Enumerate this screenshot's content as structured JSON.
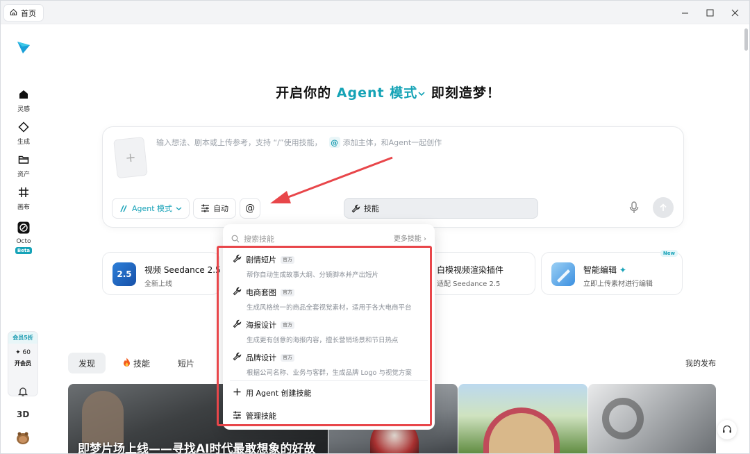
{
  "window": {
    "tab_label": "首页"
  },
  "sidebar": {
    "items": [
      {
        "label": "灵感"
      },
      {
        "label": "生成"
      },
      {
        "label": "资产"
      },
      {
        "label": "画布"
      },
      {
        "label": "Octo",
        "badge": "Beta"
      }
    ],
    "vip": {
      "promo": "会员5折",
      "points": "✦ 60",
      "open_label": "开会员"
    },
    "bottom_3d": "3D"
  },
  "hero": {
    "prefix": "开启你的",
    "mode": "Agent 模式",
    "suffix": "即刻造梦！"
  },
  "prompt": {
    "placeholder_left": "输入想法、剧本或上传参考，支持 “/”使用技能，",
    "placeholder_right": "添加主体，和Agent一起创作",
    "add_symbol": "+"
  },
  "toolbar": {
    "agent_label": "Agent 模式",
    "auto_label": "自动",
    "skill_label": "技能",
    "at_label": "@"
  },
  "feature_cards": [
    {
      "title": "视频 Seedance 2.5",
      "subtitle": "全新上线",
      "icon_text": "2.5"
    },
    {
      "title": "白模视频渲染插件",
      "subtitle": "适配 Seedance 2.5"
    },
    {
      "title": "智能编辑",
      "subtitle": "立即上传素材进行编辑",
      "badge": "New"
    }
  ],
  "content_tabs": [
    {
      "label": "发现"
    },
    {
      "label": "技能"
    },
    {
      "label": "短片"
    }
  ],
  "my_publish": "我的发布",
  "gallery": {
    "caption": "即梦片场上线——寻找AI时代最敢想象的好故"
  },
  "skills_menu": {
    "search_placeholder": "搜索技能",
    "more_label": "更多技能",
    "official_tag": "官方",
    "items": [
      {
        "name": "剧情短片",
        "desc": "帮你自动生成故事大纲、分镜脚本并产出短片"
      },
      {
        "name": "电商套图",
        "desc": "生成风格统一的商品全套视觉素材，适用于各大电商平台"
      },
      {
        "name": "海报设计",
        "desc": "生成更有创意的海报内容，擅长营销场景和节日热点"
      },
      {
        "name": "品牌设计",
        "desc": "根据公司名称、业务与客群，生成品牌 Logo 与视觉方案"
      }
    ],
    "create_label": "用 Agent 创建技能",
    "manage_label": "管理技能"
  },
  "colors": {
    "accent": "#15a3b6",
    "annotation_red": "#e8464a"
  }
}
